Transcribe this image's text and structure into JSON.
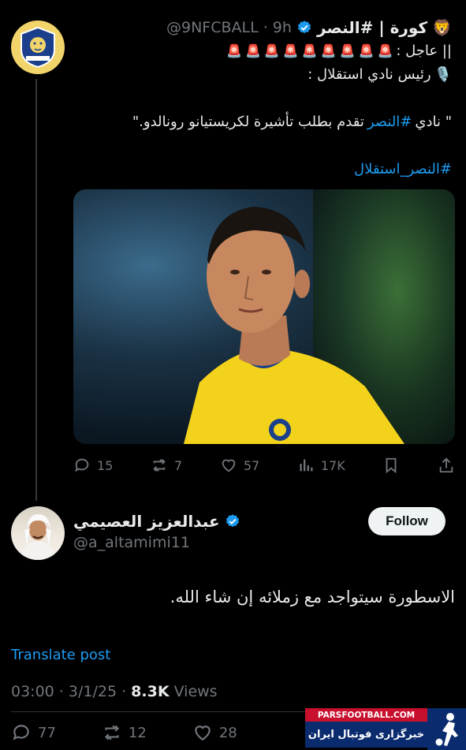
{
  "tweet1": {
    "name": "كورة | #النصر",
    "name_emoji": "🦁",
    "handle_time": "@9NFCBALL · 9h",
    "line1_text": "|| عاجل :",
    "siren_count": 9,
    "line2_text": "رئيس نادي استقلال :",
    "quote_prefix": "\" نادي ",
    "quote_tag": "#النصر",
    "quote_suffix": " تقدم بطلب تأشيرة لكريستيانو رونالدو.\"",
    "hashtag": "#النصر_استقلال",
    "actions": {
      "replies": "15",
      "retweets": "7",
      "likes": "57",
      "views": "17K"
    }
  },
  "tweet2": {
    "name": "عبدالعزيز العصيمي",
    "handle": "@a_altamimi11",
    "follow_label": "Follow",
    "text": "الاسطورة سيتواجد مع زملائه إن شاء الله.",
    "translate_label": "Translate post",
    "time": "03:00 · 3/1/25 · ",
    "views_count": "8.3K",
    "views_label": " Views",
    "actions": {
      "replies": "77",
      "retweets": "12",
      "likes": "28"
    }
  },
  "watermark": {
    "top": "PARSFOOTBALL.COM",
    "bottom": "خبرگزاری فوتبال ایران"
  },
  "colors": {
    "accent": "#1d9bf0",
    "muted": "#71767b",
    "background": "#000000"
  }
}
